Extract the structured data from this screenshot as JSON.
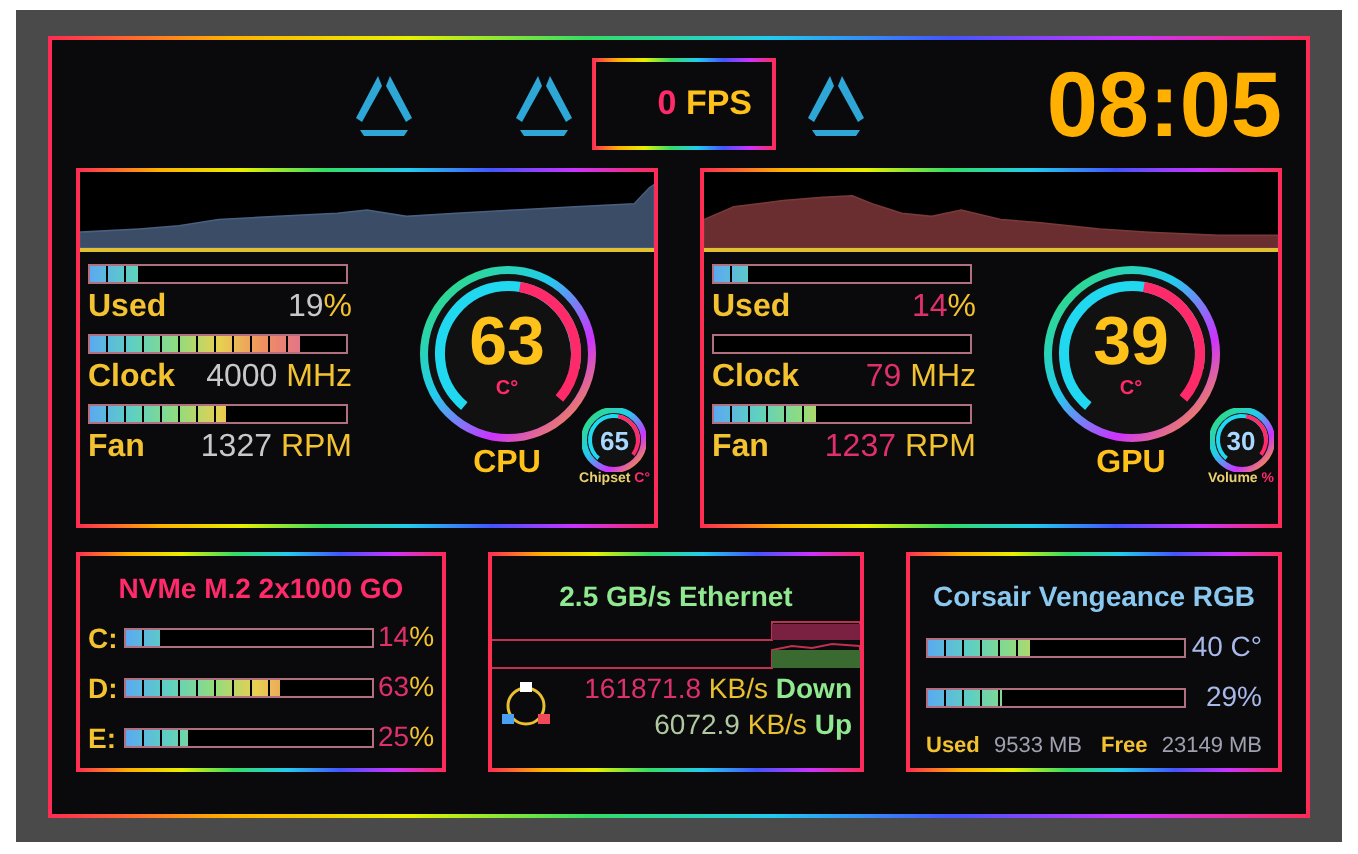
{
  "top_bar": {
    "fps": {
      "value": "0",
      "unit": "FPS"
    },
    "clock": "08:05"
  },
  "panels": [
    {
      "kind": "cpu",
      "metrics": [
        {
          "label": "Used",
          "value": "19",
          "unit": "%",
          "level": 0.19
        },
        {
          "label": "Clock",
          "value": "4000",
          "unit": "MHz",
          "level": 0.82
        },
        {
          "label": "Fan",
          "value": "1327",
          "unit": "RPM",
          "level": 0.53
        }
      ],
      "gauge": {
        "value": "63",
        "unit": "C°",
        "label": "CPU"
      },
      "sub_gauge": {
        "value": "65",
        "label": "Chipset",
        "unit": "C°"
      }
    },
    {
      "kind": "gpu",
      "metrics": [
        {
          "label": "Used",
          "value": "14",
          "unit": "%",
          "level": 0.14
        },
        {
          "label": "Clock",
          "value": "79",
          "unit": "MHz",
          "level": 0
        },
        {
          "label": "Fan",
          "value": "1237",
          "unit": "RPM",
          "level": 0.4
        }
      ],
      "gauge": {
        "value": "39",
        "unit": "C°",
        "label": "GPU"
      },
      "sub_gauge": {
        "value": "30",
        "label": "Volume",
        "unit": "%"
      }
    }
  ],
  "storage": {
    "title": "NVMe M.2 2x1000 GO",
    "drives": [
      {
        "label": "C:",
        "value": "14",
        "unit": "%",
        "level": 0.14
      },
      {
        "label": "D:",
        "value": "63",
        "unit": "%",
        "level": 0.63
      },
      {
        "label": "E:",
        "value": "25",
        "unit": "%",
        "level": 0.25
      }
    ]
  },
  "network": {
    "title": "2.5 GB/s Ethernet",
    "rates": [
      {
        "kind": "down",
        "value": "161871.8",
        "unit": "KB/s",
        "label": "Down"
      },
      {
        "kind": "up",
        "value": "6072.9",
        "unit": "KB/s",
        "label": "Up"
      }
    ]
  },
  "memory": {
    "title": "Corsair Vengeance RGB",
    "bars": [
      {
        "value": "40",
        "unit": "C°",
        "level": 0.4
      },
      {
        "value": "29",
        "unit": "%",
        "level": 0.29
      }
    ],
    "stats": [
      {
        "label": "Used",
        "value": "9533 MB"
      },
      {
        "label": "Free",
        "value": "23149 MB"
      }
    ]
  }
}
